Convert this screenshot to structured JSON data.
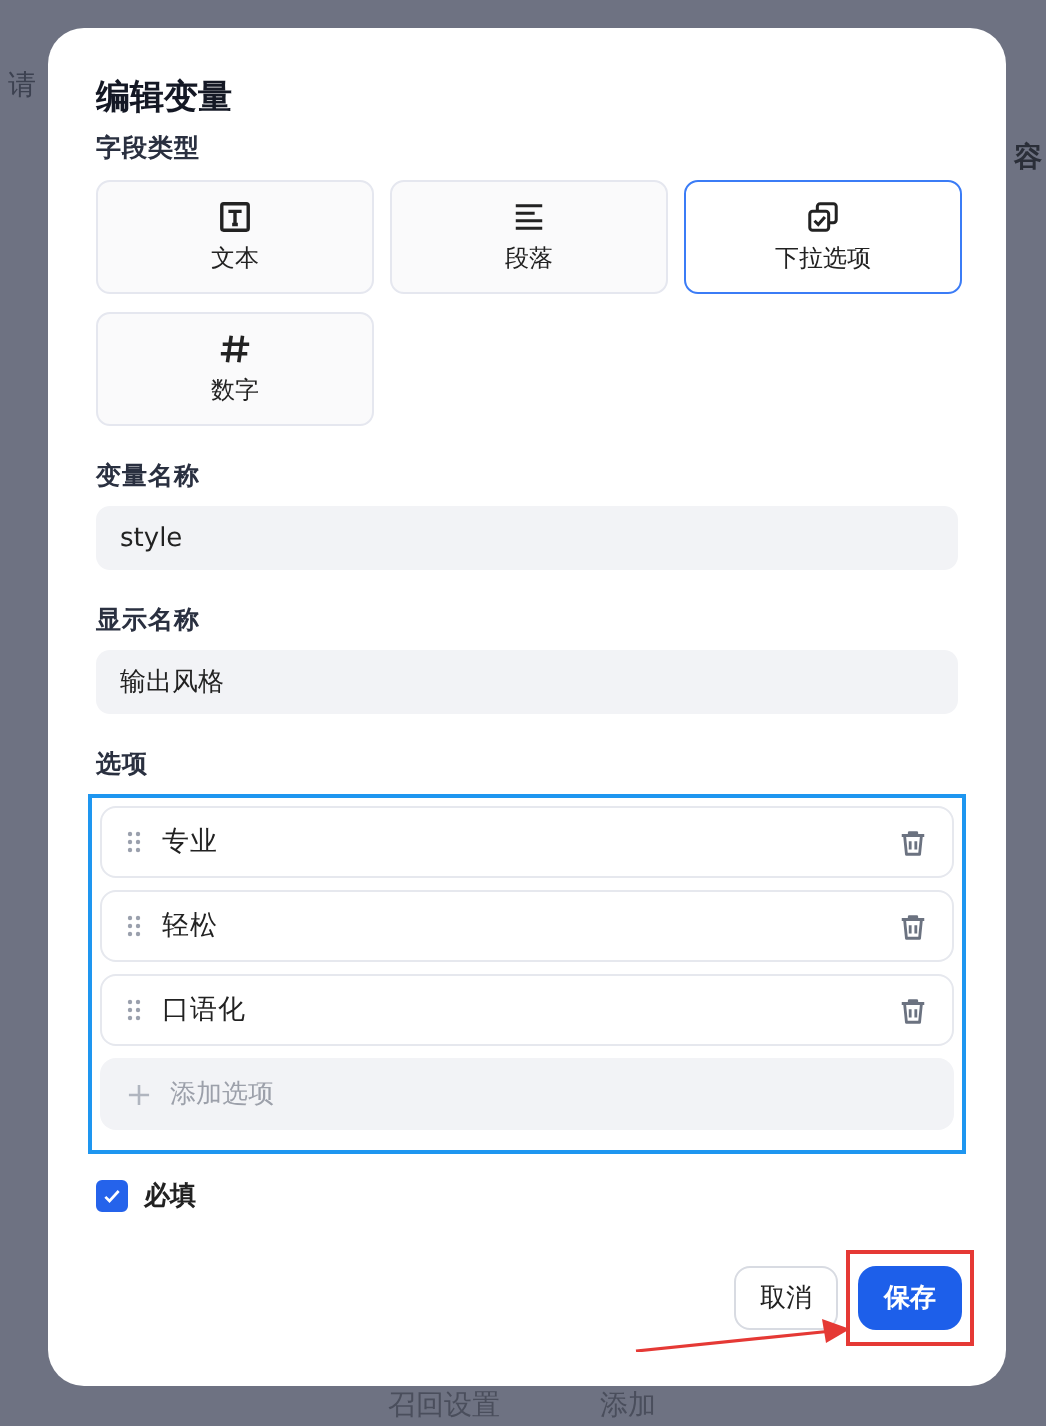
{
  "background": {
    "top_left_text": "请",
    "top_right_text": "容",
    "bottom_texts": [
      "召回设置",
      "添加"
    ]
  },
  "dialog": {
    "title": "编辑变量",
    "field_type": {
      "label": "字段类型",
      "types": [
        {
          "kind": "text",
          "label": "文本",
          "selected": false
        },
        {
          "kind": "paragraph",
          "label": "段落",
          "selected": false
        },
        {
          "kind": "dropdown",
          "label": "下拉选项",
          "selected": true
        },
        {
          "kind": "number",
          "label": "数字",
          "selected": false
        }
      ]
    },
    "variable_name": {
      "label": "变量名称",
      "value": "style"
    },
    "display_name": {
      "label": "显示名称",
      "value": "输出风格"
    },
    "options": {
      "label": "选项",
      "highlighted": true,
      "items": [
        "专业",
        "轻松",
        "口语化"
      ],
      "add_label": "添加选项"
    },
    "required": {
      "label": "必填",
      "checked": true
    },
    "buttons": {
      "cancel": "取消",
      "save": {
        "label": "保存",
        "highlighted": true,
        "pointer_arrow": true
      }
    }
  }
}
